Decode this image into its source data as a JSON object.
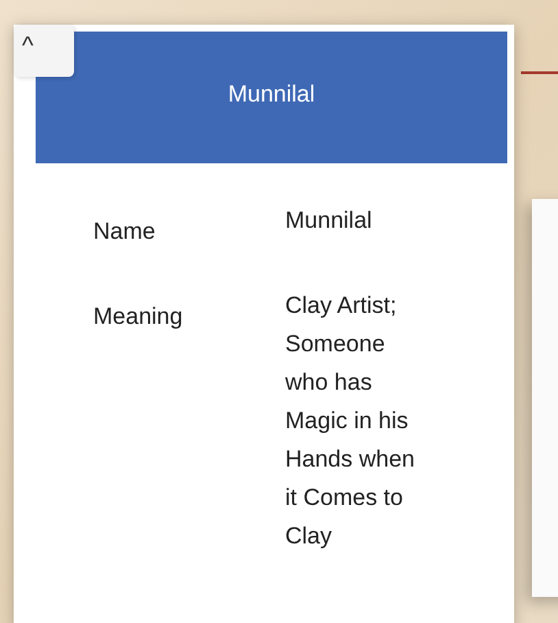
{
  "card": {
    "title": "Munnilal",
    "collapse_button": {
      "label": "^"
    },
    "rows": [
      {
        "label": "Name",
        "value_lines": [
          "Munnilal"
        ]
      },
      {
        "label": "Meaning",
        "value_lines": [
          "Clay Artist;",
          "Someone",
          "who has",
          "Magic in his",
          "Hands when",
          "it Comes to",
          "Clay"
        ]
      }
    ]
  }
}
